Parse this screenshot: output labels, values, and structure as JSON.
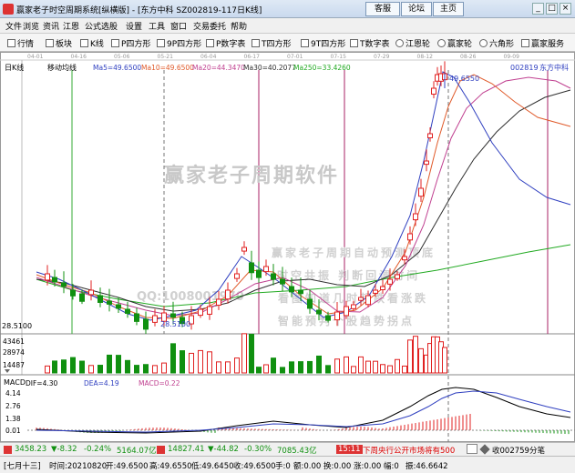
{
  "window": {
    "title": "赢家老子时空周期系统[纵横版] - [东方中科  SZ002819-117日K线]",
    "links": [
      "客服",
      "论坛",
      "主页"
    ],
    "controls": [
      "_",
      "□",
      "×"
    ]
  },
  "menu": [
    "文件",
    "浏览",
    "资讯",
    "江恩",
    "公式选股",
    "设置",
    "工具",
    "窗口",
    "交易委托",
    "帮助"
  ],
  "toolbar": [
    "行情",
    "板块",
    "K线",
    "P四方形",
    "9P四方形",
    "P数字表",
    "T四方形",
    "9T四方形",
    "T数字表",
    "江恩轮",
    "赢家轮",
    "六角形",
    "赢家服务"
  ],
  "chart": {
    "panel_label": "日K线",
    "indicator_title": "移动均线",
    "ma_labels": [
      "Ma5=49.6500",
      "Ma10=49.6500",
      "Ma20=44.3470",
      "Ma30=40.2077",
      "Ma250=33.4260"
    ],
    "ma_colors": [
      "#3040c0",
      "#e05a2a",
      "#c04090",
      "#303030",
      "#22aa22"
    ],
    "date_ticks": [
      "04-01",
      "04-16",
      "05-06",
      "05-21",
      "06-04",
      "06-17",
      "07-01",
      "07-15",
      "07-29",
      "08-12",
      "08-26",
      "09-09"
    ],
    "stock_code": "002819",
    "stock_name": "东方中科",
    "high_price": "49.6550",
    "low_price": "28.5100",
    "left_price": "28.5100",
    "watermark_title": "赢家老子周期软件",
    "watermark_lines": [
      "赢家老子周期自动预测顶底",
      "时空共振  判断回调时间",
      "看图知道几时起跌看涨跌",
      "智能预判个股趋势拐点"
    ],
    "watermark_qq": "QQ:1008001970",
    "volume_ticks": [
      "43461",
      "28974",
      "14487"
    ],
    "macd_label": "MACD",
    "macd_values": [
      "DIF=4.30",
      "DEA=4.19",
      "MACD=0.22"
    ],
    "macd_ticks": [
      "4.14",
      "2.76",
      "1.38",
      "0.01"
    ],
    "colors": {
      "up": "#e02020",
      "down": "#109010",
      "ma5": "#3040c0",
      "ma10": "#e05a2a",
      "ma20": "#c04090",
      "ma30": "#303030",
      "ma250": "#22aa22"
    }
  },
  "quotes": {
    "sh": "3458.23",
    "sh_change": "▼-8.32",
    "sh_pct": "-0.24%",
    "sh_amount": "5164.07亿",
    "sz": "14827.41",
    "sz_change": "▼-44.82",
    "sz_pct": "-0.30%",
    "sz_amount": "7085.43亿",
    "time": "15:11",
    "news": "下周央行公开市场将有500",
    "notice": "收002759分笔"
  },
  "status": {
    "weekday": "[七月十三]",
    "date": "时间:20210820",
    "open": "开:49.6500",
    "high": "高:49.6550",
    "low": "低:49.6450",
    "close": "收:49.6500",
    "hand": "手:0",
    "amount": "额:0.00",
    "turnover": "换:0.00",
    "change": "涨:0.00",
    "amp": "幅:0",
    "ratio": "振:46.6642"
  }
}
